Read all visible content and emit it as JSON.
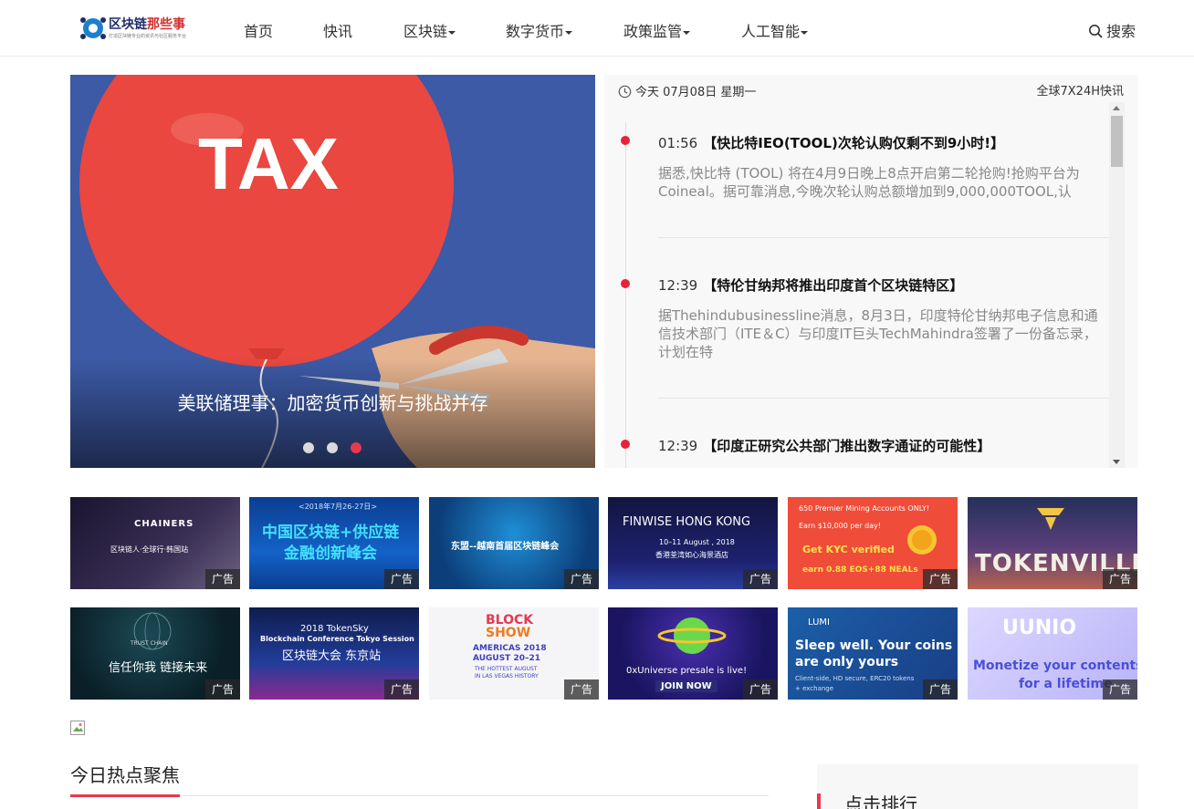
{
  "header": {
    "logo": {
      "title_cn": "区块链",
      "title_red": "那些事",
      "subtitle": "打造区块链专业的资讯与社区服务平台"
    },
    "nav": [
      {
        "label": "首页",
        "dropdown": false
      },
      {
        "label": "快讯",
        "dropdown": false
      },
      {
        "label": "区块链",
        "dropdown": true
      },
      {
        "label": "数字货币",
        "dropdown": true
      },
      {
        "label": "政策监管",
        "dropdown": true
      },
      {
        "label": "人工智能",
        "dropdown": true
      }
    ],
    "search_label": "搜索"
  },
  "hero": {
    "balloon_text": "TAX",
    "caption": "美联储理事：加密货币创新与挑战并存",
    "slide_count": 3,
    "active_slide": 3
  },
  "flash": {
    "date": "今天 07月08日 星期一",
    "global_label": "全球7X24H快讯",
    "items": [
      {
        "time": "01:56",
        "title": "【快比特IEO(TOOL)次轮认购仅剩不到9小时!】",
        "body": "据悉,快比特 (TOOL) 将在4月9日晚上8点开启第二轮抢购!抢购平台为Coineal。据可靠消息,今晚次轮认购总额增加到9,000,000TOOL,认"
      },
      {
        "time": "12:39",
        "title": "【特伦甘纳邦将推出印度首个区块链特区】",
        "body": "据Thehindubusinessline消息，8月3日，印度特伦甘纳邦电子信息和通信技术部门（ITE＆C）与印度IT巨头TechMahindra签署了一份备忘录，计划在特"
      },
      {
        "time": "12:39",
        "title": "【印度正研究公共部门推出数字通证的可能性】",
        "body": ""
      }
    ]
  },
  "ads": {
    "tag": "广告",
    "items": [
      {
        "lines": [
          "CHAINERS",
          "区块链人·全球行·韩国站"
        ]
      },
      {
        "lines": [
          "<2018年7月26-27日>",
          "中国区块链+供应链",
          "金融创新峰会"
        ]
      },
      {
        "lines": [
          "东盟--越南首届区块链峰会"
        ]
      },
      {
        "lines": [
          "FINWISE HONG KONG",
          "10–11 August , 2018",
          "香港荃湾如心海景酒店"
        ]
      },
      {
        "lines": [
          "650 Premier Mining Accounts ONLY!",
          "Earn $10,000 per day!",
          "Get KYC verified",
          "earn 0.88 EOS+88 NEALs"
        ]
      },
      {
        "lines": [
          "TOKENVILLE"
        ]
      },
      {
        "lines": [
          "TRUST CHAIN",
          "信任你我  链接未来"
        ]
      },
      {
        "lines": [
          "2018 TokenSky",
          "Blockchain Conference Tokyo Session",
          "区块链大会 东京站"
        ]
      },
      {
        "lines": [
          "BLOCK",
          "SHOW",
          "AMERICAS 2018",
          "AUGUST 20–21",
          "THE HOTTEST AUGUST",
          "IN LAS VEGAS HISTORY"
        ]
      },
      {
        "lines": [
          "0xUniverse presale is live!",
          "JOIN NOW"
        ]
      },
      {
        "lines": [
          "LUMI",
          "Sleep well. Your coins",
          "are only yours",
          "Client-side, HD secure, ERC20 tokens",
          "+ exchange"
        ]
      },
      {
        "lines": [
          "UUNIO",
          "Monetize your contents",
          "for a lifetime"
        ]
      }
    ]
  },
  "hot": {
    "title": "今日热点聚焦"
  },
  "rank": {
    "title": "点击排行"
  },
  "colors": {
    "accent": "#e8384f",
    "dot": "#e8223b"
  }
}
